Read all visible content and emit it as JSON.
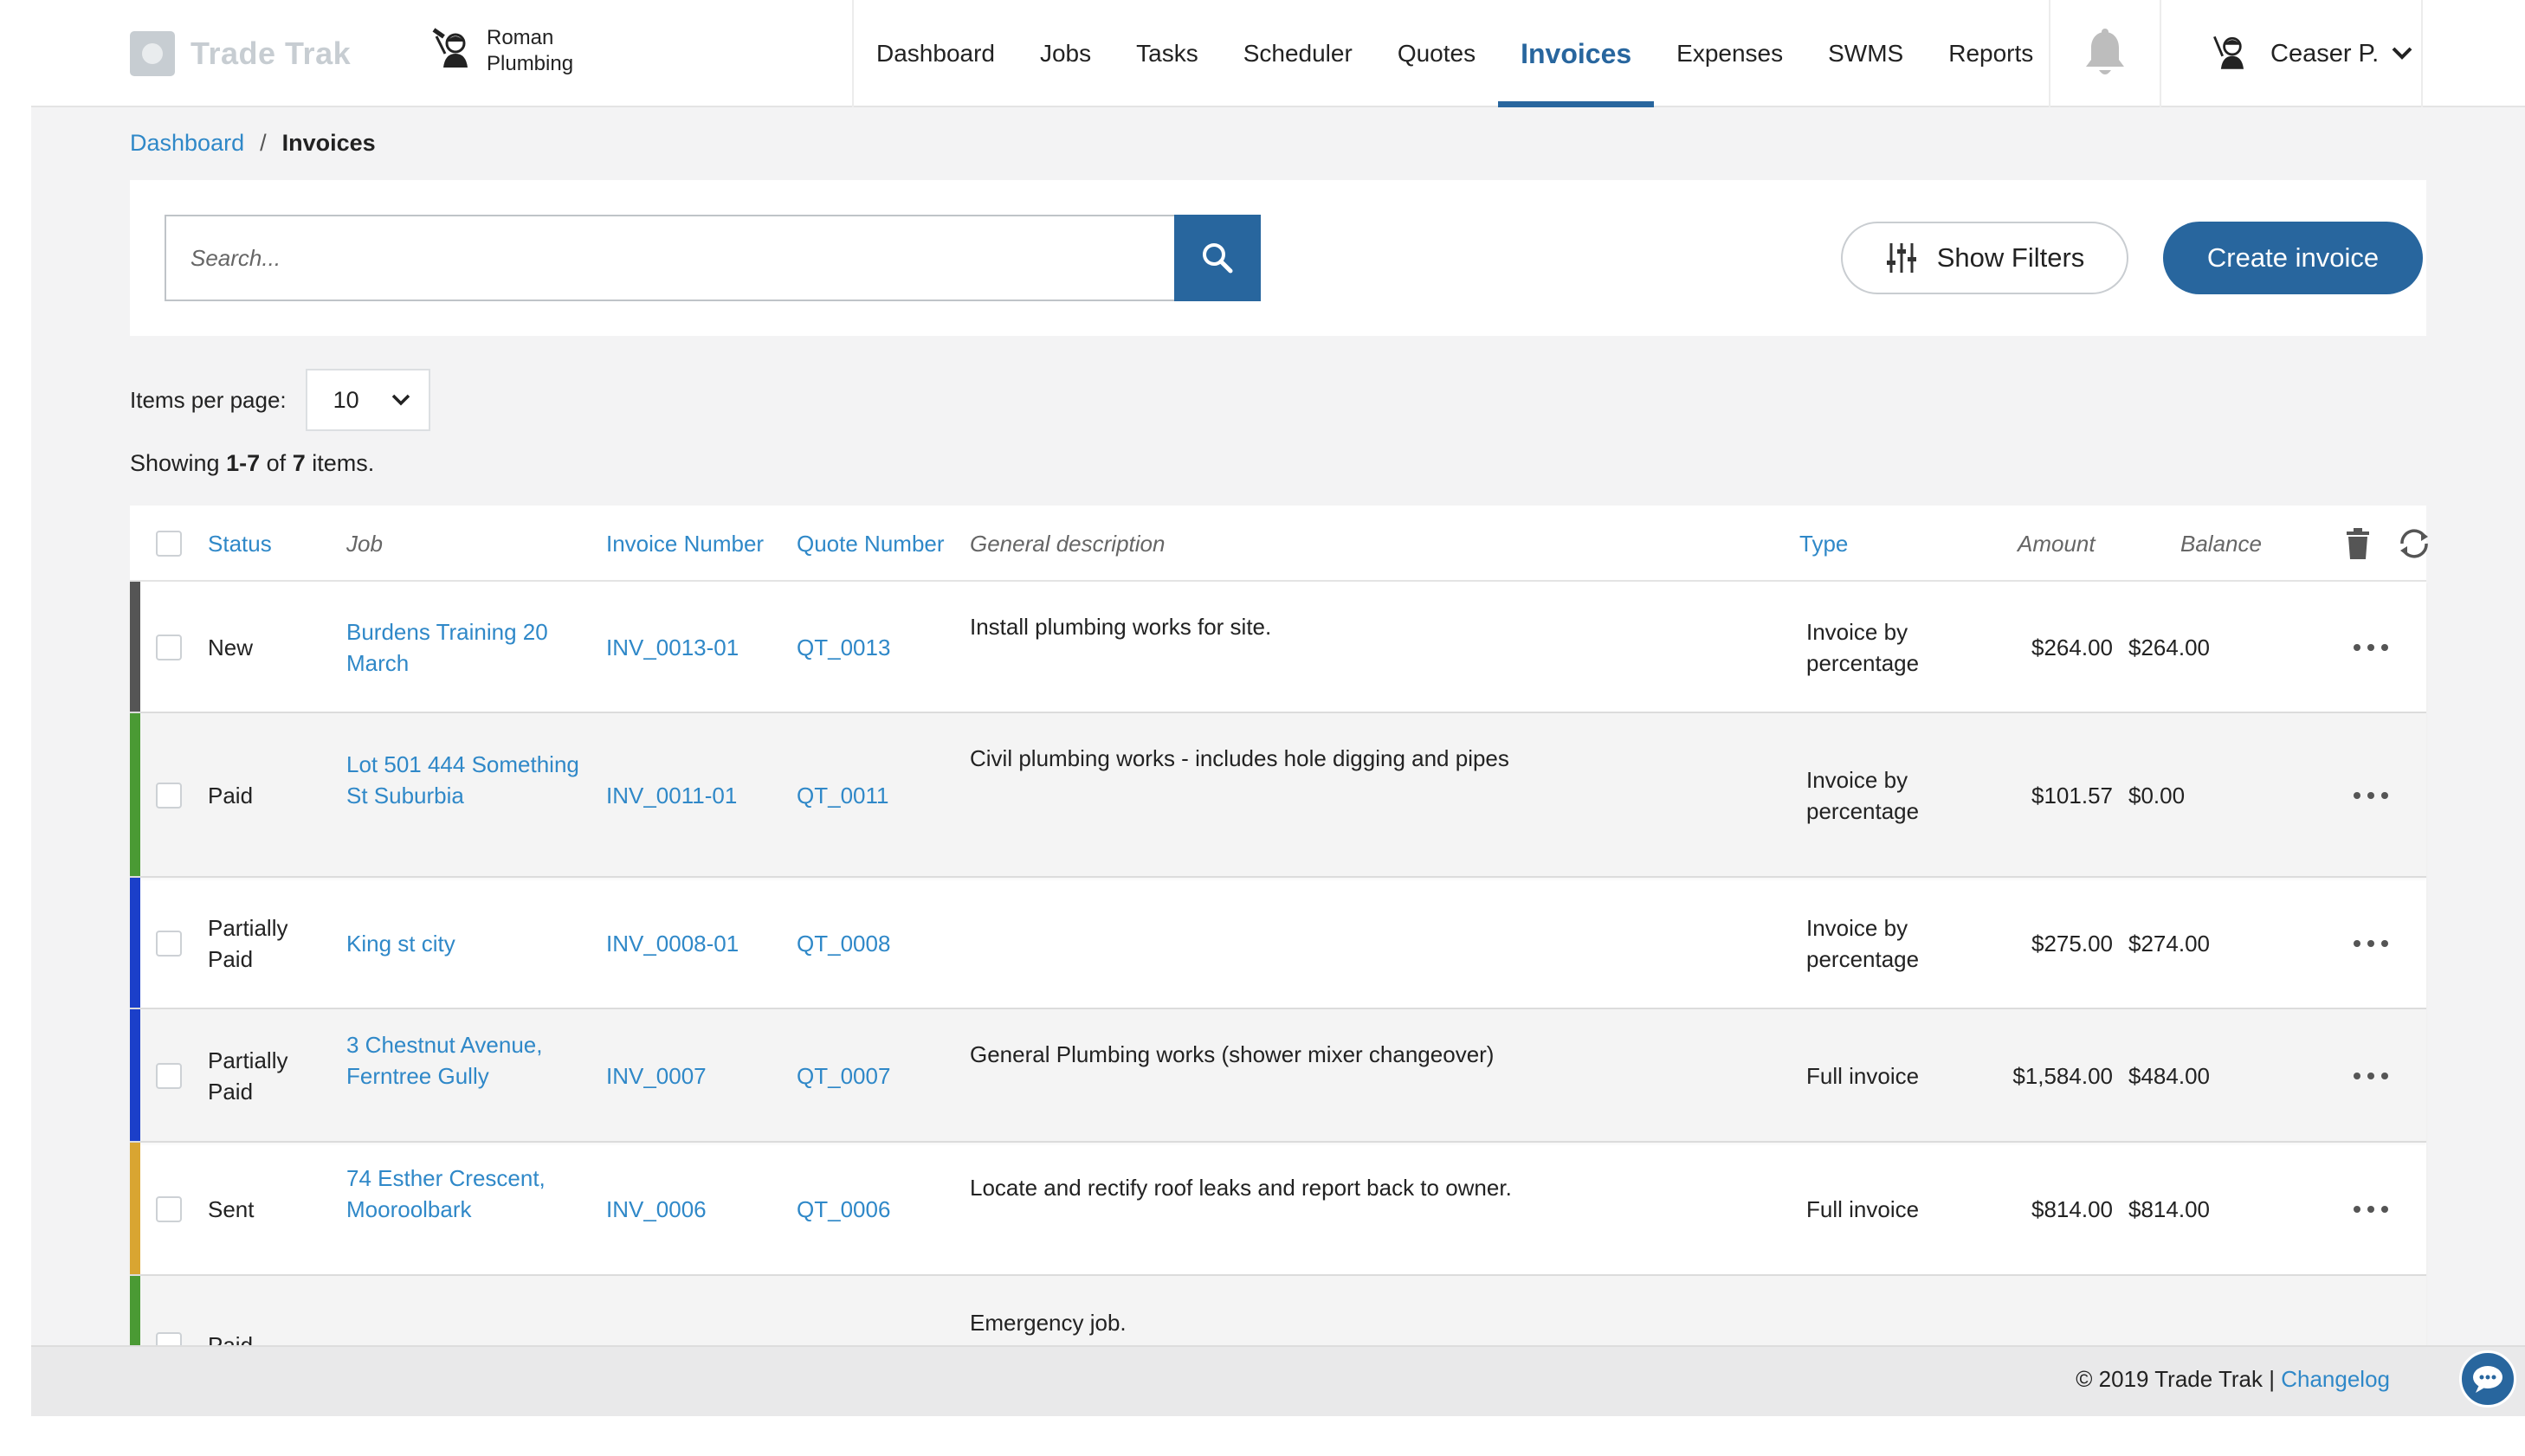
{
  "app": {
    "brand": "Trade Trak",
    "company": "Roman Plumbing",
    "accent": "#28669e",
    "link_color": "#2f88c8"
  },
  "nav": {
    "items": [
      {
        "label": "Dashboard",
        "active": false
      },
      {
        "label": "Jobs",
        "active": false
      },
      {
        "label": "Tasks",
        "active": false
      },
      {
        "label": "Scheduler",
        "active": false
      },
      {
        "label": "Quotes",
        "active": false
      },
      {
        "label": "Invoices",
        "active": true
      },
      {
        "label": "Expenses",
        "active": false
      },
      {
        "label": "SWMS",
        "active": false
      },
      {
        "label": "Reports",
        "active": false
      }
    ],
    "icons": [
      "bell-icon",
      "user-avatar",
      "chevron-down-icon"
    ]
  },
  "user": {
    "name": "Ceaser P."
  },
  "breadcrumb": {
    "parent": "Dashboard",
    "separator": "/",
    "current": "Invoices"
  },
  "toolbar": {
    "search_placeholder": "Search...",
    "filters_label": "Show Filters",
    "create_label": "Create invoice"
  },
  "pagination": {
    "items_per_page_label": "Items per page:",
    "items_per_page_value": "10",
    "showing_prefix": "Showing",
    "showing_range": "1-7",
    "showing_of": "of",
    "showing_total": "7",
    "showing_suffix": "items."
  },
  "table": {
    "columns": {
      "status": "Status",
      "job": "Job",
      "invoice_number": "Invoice Number",
      "quote_number": "Quote Number",
      "description": "General description",
      "type": "Type",
      "amount": "Amount",
      "balance": "Balance"
    },
    "status_colors": {
      "New": "#555555",
      "Paid": "#4a9a34",
      "Partially Paid": "#1b3fc9",
      "Sent": "#d9a531"
    },
    "rows": [
      {
        "status": "New",
        "job": "Burdens Training 20 March",
        "invoice": "INV_0013-01",
        "quote": "QT_0013",
        "description": "Install plumbing works for site.",
        "type": "Invoice by percentage",
        "amount": "$264.00",
        "balance": "$264.00"
      },
      {
        "status": "Paid",
        "job": "Lot 501 444 Something St Suburbia",
        "invoice": "INV_0011-01",
        "quote": "QT_0011",
        "description": "Civil plumbing works - includes hole digging and pipes",
        "type": "Invoice by percentage",
        "amount": "$101.57",
        "balance": "$0.00"
      },
      {
        "status": "Partially Paid",
        "job": "King st city",
        "invoice": "INV_0008-01",
        "quote": "QT_0008",
        "description": "",
        "type": "Invoice by percentage",
        "amount": "$275.00",
        "balance": "$274.00"
      },
      {
        "status": "Partially Paid",
        "job": "3 Chestnut Avenue, Ferntree Gully",
        "invoice": "INV_0007",
        "quote": "QT_0007",
        "description": "General Plumbing works (shower mixer changeover)",
        "type": "Full invoice",
        "amount": "$1,584.00",
        "balance": "$484.00"
      },
      {
        "status": "Sent",
        "job": "74 Esther Crescent, Mooroolbark",
        "invoice": "INV_0006",
        "quote": "QT_0006",
        "description": "Locate and rectify roof leaks and report back to owner.",
        "type": "Full invoice",
        "amount": "$814.00",
        "balance": "$814.00"
      },
      {
        "status": "Paid",
        "job": "",
        "invoice": "",
        "quote": "",
        "description": "Emergency job.",
        "type": "",
        "amount": "",
        "balance": ""
      }
    ]
  },
  "footer": {
    "copyright": "© 2019 Trade Trak |",
    "changelog": "Changelog"
  }
}
